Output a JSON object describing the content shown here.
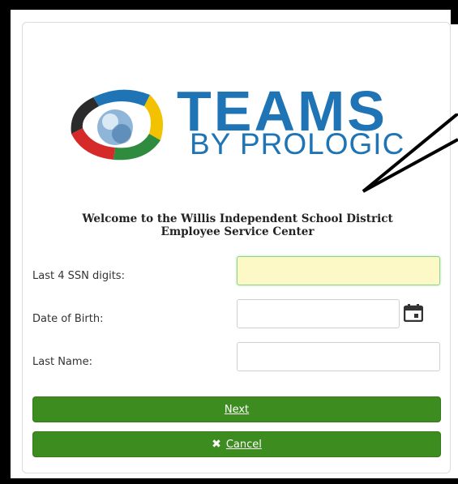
{
  "logo": {
    "wordmark": "TEAMS",
    "tagline": "BY PROLOGIC",
    "icon": "prologic-ring-logo"
  },
  "welcome": {
    "line1": "Welcome to the Willis Independent School District",
    "line2": "Employee Service Center"
  },
  "form": {
    "ssn_label": "Last 4 SSN digits:",
    "ssn_value": "",
    "dob_label": "Date of Birth:",
    "dob_value": "",
    "lastname_label": "Last Name:",
    "lastname_value": ""
  },
  "buttons": {
    "next_label": "Next",
    "cancel_label": "Cancel"
  },
  "icons": {
    "calendar": "calendar-icon",
    "cancel": "close-icon"
  },
  "colors": {
    "brand_blue": "#1e74b5",
    "button_green": "#3d8c1f",
    "active_field": "#fdf9c7"
  }
}
